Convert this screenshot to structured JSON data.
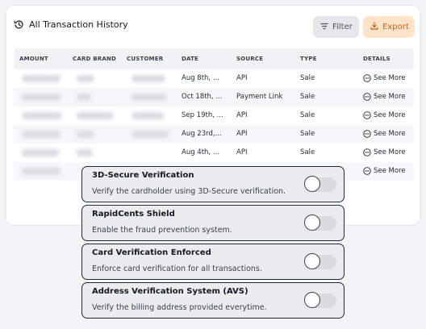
{
  "header": {
    "title": "All Transaction History",
    "filter_label": "Filter",
    "export_label": "Export"
  },
  "table": {
    "columns": [
      "AMOUNT",
      "CARD BRAND",
      "CUSTOMER",
      "DATE",
      "SOURCE",
      "TYPE",
      "DETAILS"
    ],
    "rows": [
      {
        "date": "Aug 8th, ...",
        "source": "API",
        "type": "Sale",
        "details": "See More"
      },
      {
        "date": "Oct 18th, ...",
        "source": "Payment Link",
        "type": "Sale",
        "details": "See More"
      },
      {
        "date": "Sep 19th, ...",
        "source": "API",
        "type": "Sale",
        "details": "See More"
      },
      {
        "date": "Aug 23rd,...",
        "source": "API",
        "type": "Sale",
        "details": "See More"
      },
      {
        "date": "Aug 4th, ...",
        "source": "API",
        "type": "Sale",
        "details": "See More"
      },
      {
        "date": "",
        "source": "",
        "type": "",
        "details": "See More"
      }
    ]
  },
  "settings": [
    {
      "title": "3D-Secure Verification",
      "description": "Verify the cardholder using 3D-Secure verification.",
      "enabled": false
    },
    {
      "title": "RapidCents Shield",
      "description": "Enable the fraud prevention system.",
      "enabled": false
    },
    {
      "title": "Card Verification Enforced",
      "description": "Enforce card verification for all transactions.",
      "enabled": false
    },
    {
      "title": "Address Verification System (AVS)",
      "description": "Verify the billing address provided everytime.",
      "enabled": false
    }
  ],
  "colors": {
    "export_accent": "#c2621a",
    "export_bg": "#fde4c8"
  }
}
